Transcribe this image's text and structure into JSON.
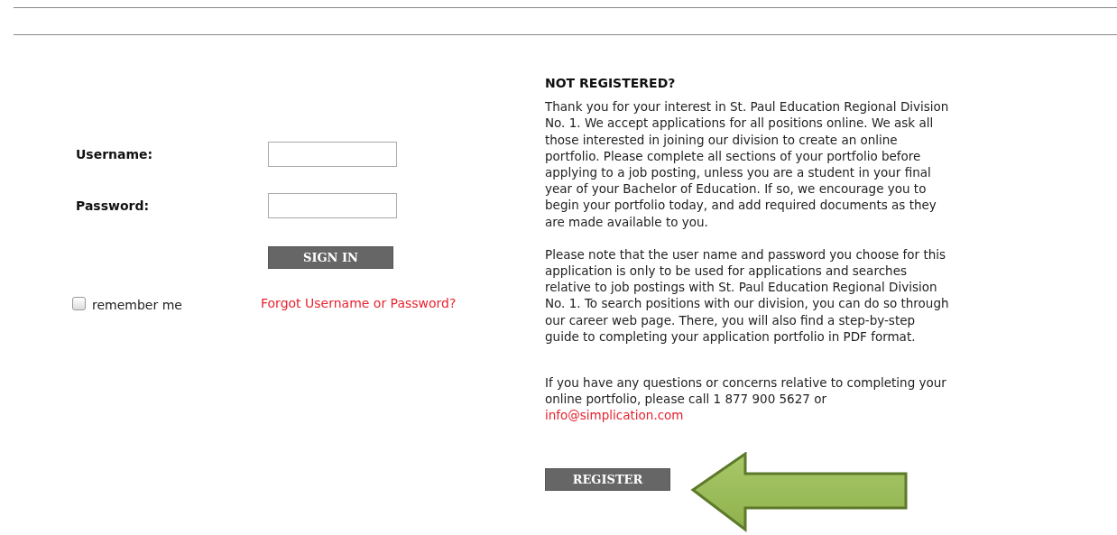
{
  "login": {
    "username_label": "Username:",
    "password_label": "Password:",
    "sign_in_button": "SIGN IN",
    "remember_me": {
      "label": "remember me",
      "checked": false
    },
    "forgot_link": "Forgot Username or Password?"
  },
  "register": {
    "heading": "NOT REGISTERED?",
    "paragraphs": [
      "Thank you for your interest in St. Paul Education Regional Division No. 1. We accept applications for all positions online. We ask all those interested in joining our division to create an online portfolio. Please complete all sections of your portfolio before applying to a job posting, unless you are a student in your final year of your Bachelor of Education. If so, we encourage you to begin your portfolio today, and add required documents as they are made available to you.",
      "Please note that the user name and password you choose for this application is only to be used for applications and searches relative to job postings with St. Paul Education Regional Division No. 1. To search positions with our division, you can do so through our career web page. There, you will also find a step-by-step guide to completing your application portfolio in PDF format."
    ],
    "contact_text": "If you have any questions or concerns relative to completing your online portfolio, please call 1 877 900 5627 or",
    "contact_link": "info@simplication.com",
    "register_button": "REGISTER"
  }
}
